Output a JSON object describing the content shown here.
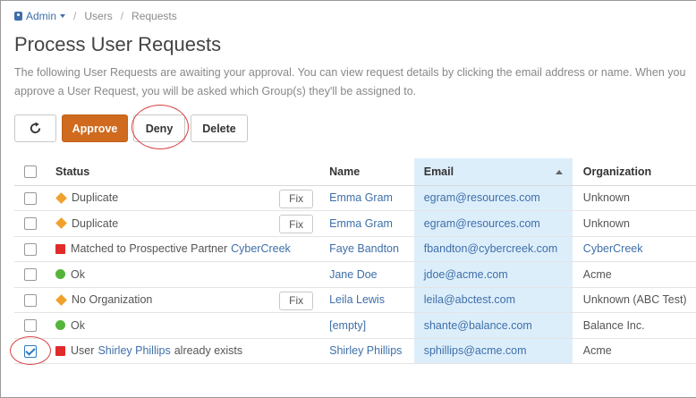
{
  "breadcrumb": {
    "admin_label": "Admin",
    "users_label": "Users",
    "requests_label": "Requests"
  },
  "page": {
    "title": "Process User Requests",
    "intro": "The following User Requests are awaiting your approval. You can view request details by clicking the email address or name. When you approve a User Request, you will be asked which Group(s) they'll be assigned to."
  },
  "toolbar": {
    "refresh_icon": "refresh-icon",
    "approve_label": "Approve",
    "deny_label": "Deny",
    "delete_label": "Delete"
  },
  "table": {
    "headers": {
      "status": "Status",
      "name": "Name",
      "email": "Email",
      "organization": "Organization"
    },
    "sort": {
      "column": "email",
      "direction": "ascending"
    },
    "fix_label": "Fix",
    "rows": [
      {
        "checked": false,
        "status_icon": "warning-diamond",
        "status_text": "Duplicate",
        "status_link": "",
        "status_suffix": "",
        "has_fix": true,
        "name": "Emma Gram",
        "email": "egram@resources.com",
        "organization": "Unknown",
        "org_is_link": false
      },
      {
        "checked": false,
        "status_icon": "warning-diamond",
        "status_text": "Duplicate",
        "status_link": "",
        "status_suffix": "",
        "has_fix": true,
        "name": "Emma Gram",
        "email": "egram@resources.com",
        "organization": "Unknown",
        "org_is_link": false
      },
      {
        "checked": false,
        "status_icon": "error-square",
        "status_text": "Matched to Prospective Partner",
        "status_link": "CyberCreek",
        "status_suffix": "",
        "has_fix": false,
        "name": "Faye Bandton",
        "email": "fbandton@cybercreek.com",
        "organization": "CyberCreek",
        "org_is_link": true
      },
      {
        "checked": false,
        "status_icon": "ok-dot",
        "status_text": "Ok",
        "status_link": "",
        "status_suffix": "",
        "has_fix": false,
        "name": "Jane Doe",
        "email": "jdoe@acme.com",
        "organization": "Acme",
        "org_is_link": false
      },
      {
        "checked": false,
        "status_icon": "warning-diamond",
        "status_text": "No Organization",
        "status_link": "",
        "status_suffix": "",
        "has_fix": true,
        "name": "Leila Lewis",
        "email": "leila@abctest.com",
        "organization": "Unknown (ABC Test)",
        "org_is_link": false
      },
      {
        "checked": false,
        "status_icon": "ok-dot",
        "status_text": "Ok",
        "status_link": "",
        "status_suffix": "",
        "has_fix": false,
        "name": "[empty]",
        "email": "shante@balance.com",
        "organization": "Balance Inc.",
        "org_is_link": false
      },
      {
        "checked": true,
        "status_icon": "error-square",
        "status_text": "User",
        "status_link": "Shirley Phillips",
        "status_suffix": "already exists",
        "has_fix": false,
        "name": "Shirley Phillips",
        "email": "sphillips@acme.com",
        "organization": "Acme",
        "org_is_link": false
      }
    ]
  },
  "colors": {
    "accent": "#cf6a1e",
    "link": "#3e6fa8",
    "sorted_column_bg": "#ddeefb",
    "warning": "#f0a12c",
    "error": "#e02b2b",
    "ok": "#55b43a",
    "annotation": "#d94040"
  }
}
